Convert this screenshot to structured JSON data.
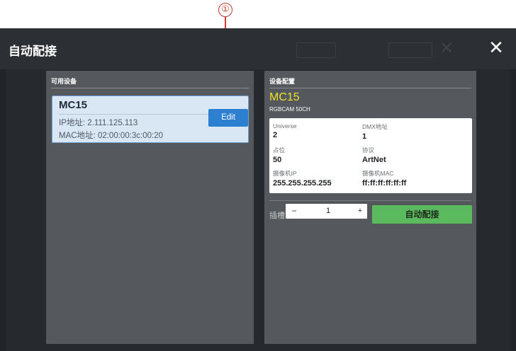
{
  "callout": {
    "number": "①"
  },
  "window": {
    "title": "自动配接",
    "close_icon": "close-icon"
  },
  "available_devices": {
    "header": "可用设备",
    "devices": [
      {
        "name": "MC15",
        "ip_text": "IP地址: 2.111.125.113",
        "mac_text": "MAC地址: 02:00:00:3c:00:20",
        "edit_label": "Edit"
      }
    ]
  },
  "device_config": {
    "header": "设备配置",
    "name": "MC15",
    "subtitle": "RGBCAM 50CH",
    "fields": [
      {
        "label": "Universe",
        "value": "2"
      },
      {
        "label": "DMX地址",
        "value": "1"
      },
      {
        "label": "占位",
        "value": "50"
      },
      {
        "label": "协议",
        "value": "ArtNet"
      },
      {
        "label": "摄像机IP",
        "value": "255.255.255.255"
      },
      {
        "label": "摄像机MAC",
        "value": "ff:ff:ff:ff:ff:ff"
      }
    ],
    "slot_label": "插槽",
    "slot_value": "1",
    "minus_symbol": "−",
    "plus_symbol": "+",
    "auto_button": "自动配接"
  },
  "colors": {
    "accent_blue": "#2d7fcf",
    "accent_green": "#5cba5e",
    "device_name_yellow": "#e9e42a",
    "callout_red": "#d63a2e"
  }
}
